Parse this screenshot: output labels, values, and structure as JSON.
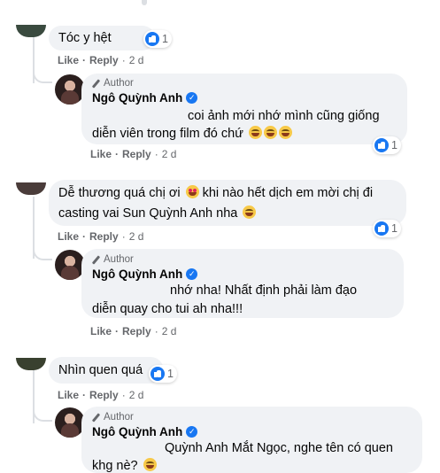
{
  "colors": {
    "bubble": "#f0f2f5",
    "link": "#65676b",
    "like_blue": "#1877f2",
    "line": "#dcdfe3"
  },
  "comments": [
    {
      "text": "Tóc y hệt",
      "reactions": "1",
      "actions": {
        "like": "Like",
        "reply": "Reply",
        "time": "2 d"
      },
      "reply": {
        "author_badge": "Author",
        "name": "Ngô Quỳnh Anh",
        "lines": [
          "coi ảnh mới nhớ mình cũng giống",
          "diễn viên trong film đó chứ"
        ],
        "reactions": "1",
        "actions": {
          "like": "Like",
          "reply": "Reply",
          "time": "2 d"
        }
      }
    },
    {
      "lines": [
        "Dễ thương quá chị ơi",
        "khi nào hết dịch em mời chị đi",
        "casting vai Sun Quỳnh Anh nha"
      ],
      "reactions": "1",
      "actions": {
        "like": "Like",
        "reply": "Reply",
        "time": "2 d"
      },
      "reply": {
        "author_badge": "Author",
        "name": "Ngô Quỳnh Anh",
        "lines": [
          "nhớ nha! Nhất định phải làm đạo",
          "diễn quay cho tui ah nha!!!"
        ],
        "actions": {
          "like": "Like",
          "reply": "Reply",
          "time": "2 d"
        }
      }
    },
    {
      "text": "Nhìn quen quá",
      "reactions": "1",
      "actions": {
        "like": "Like",
        "reply": "Reply",
        "time": "2 d"
      },
      "reply": {
        "author_badge": "Author",
        "name": "Ngô Quỳnh Anh",
        "lines": [
          "Quỳnh Anh Mắt Ngọc, nghe tên có quen",
          "khg nè?"
        ]
      }
    }
  ]
}
